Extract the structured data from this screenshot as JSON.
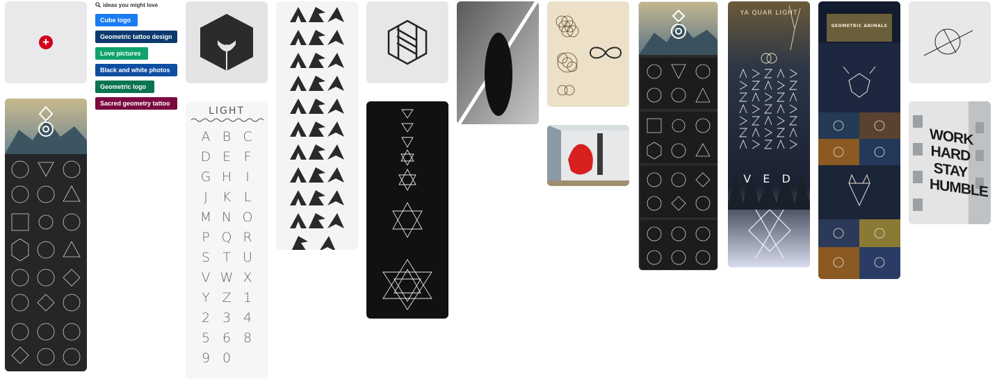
{
  "ideas_panel": {
    "heading": "ideas you might love",
    "chips": [
      {
        "label": "Cube logo",
        "color": "#1a7cf2"
      },
      {
        "label": "Geometric tattoo design",
        "color": "#0b3a6e"
      },
      {
        "label": "Love pictures",
        "color": "#10a36b"
      },
      {
        "label": "Black and white photos",
        "color": "#0e4ea3"
      },
      {
        "label": "Geometric logo",
        "color": "#0a7352"
      },
      {
        "label": "Sacred geometry tattoo",
        "color": "#7a0a3f"
      }
    ]
  },
  "pins": {
    "light_font_title": "LIGHT",
    "light_font_glyphs": [
      "A",
      "B",
      "C",
      "D",
      "E",
      "F",
      "G",
      "H",
      "I",
      "J",
      "K",
      "L",
      "M",
      "N",
      "O",
      "P",
      "Q",
      "R",
      "S",
      "T",
      "U",
      "V",
      "W",
      "X",
      "Y",
      "Z",
      "1",
      "2",
      "3",
      "4",
      "5",
      "6",
      "8",
      "9",
      "0"
    ],
    "vertical_poster": {
      "title": "YA QUAR LIGHT",
      "bottom_text": "V E D"
    },
    "geometric_animals_title": "GEOMETRIC ANIMALS",
    "typography_lines": [
      "WORK",
      "HARD",
      "STAY",
      "HUMBLE"
    ]
  },
  "colors": {
    "accent": "#d0021b",
    "placeholder": "#e9e9eb"
  }
}
